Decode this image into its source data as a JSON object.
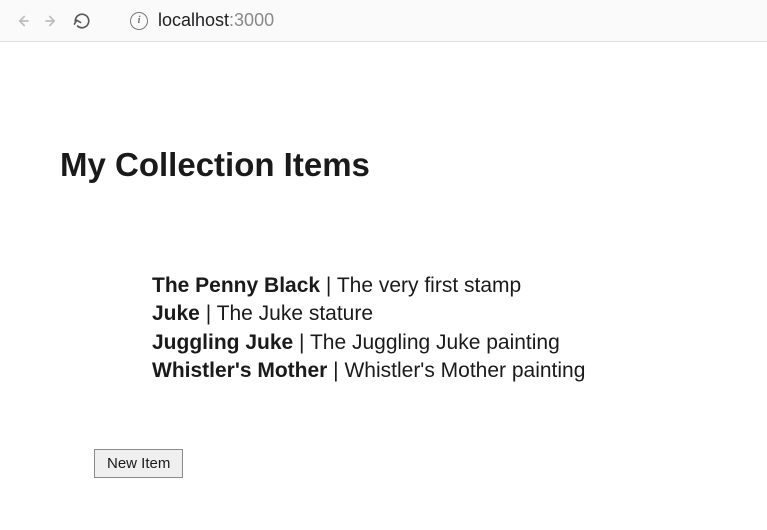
{
  "browser": {
    "url_host": "localhost",
    "url_port": ":3000"
  },
  "page": {
    "title": "My Collection Items"
  },
  "items": [
    {
      "name": "The Penny Black",
      "desc": "The very first stamp"
    },
    {
      "name": "Juke",
      "desc": "The Juke stature"
    },
    {
      "name": "Juggling Juke",
      "desc": "The Juggling Juke painting"
    },
    {
      "name": "Whistler's Mother",
      "desc": "Whistler's Mother painting"
    }
  ],
  "buttons": {
    "new_item": "New Item"
  },
  "separators": {
    "item": " | "
  }
}
